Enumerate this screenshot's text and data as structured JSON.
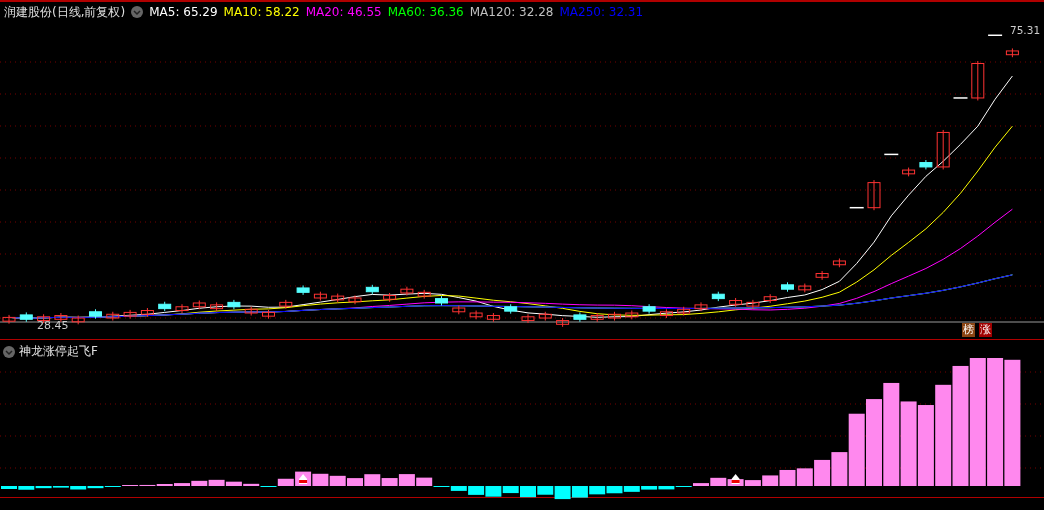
{
  "title": "润建股份(日线,前复权)",
  "ma_legend": [
    {
      "label": "MA5: 65.29",
      "color": "#ffffff"
    },
    {
      "label": "MA10: 58.22",
      "color": "#ffff00"
    },
    {
      "label": "MA20: 46.55",
      "color": "#ff00ff"
    },
    {
      "label": "MA60: 36.36",
      "color": "#00ff00"
    },
    {
      "label": "MA120: 32.28",
      "color": "#c0c0c0"
    },
    {
      "label": "MA250: 32.31",
      "color": "#0000ff"
    }
  ],
  "price_labels": {
    "high": "75.31",
    "low": "28.45"
  },
  "badges": [
    {
      "text": "榜",
      "color": "#8b4513"
    },
    {
      "text": "涨",
      "color": "#a00000"
    }
  ],
  "indicator": {
    "title": "神龙涨停起飞F"
  }
}
